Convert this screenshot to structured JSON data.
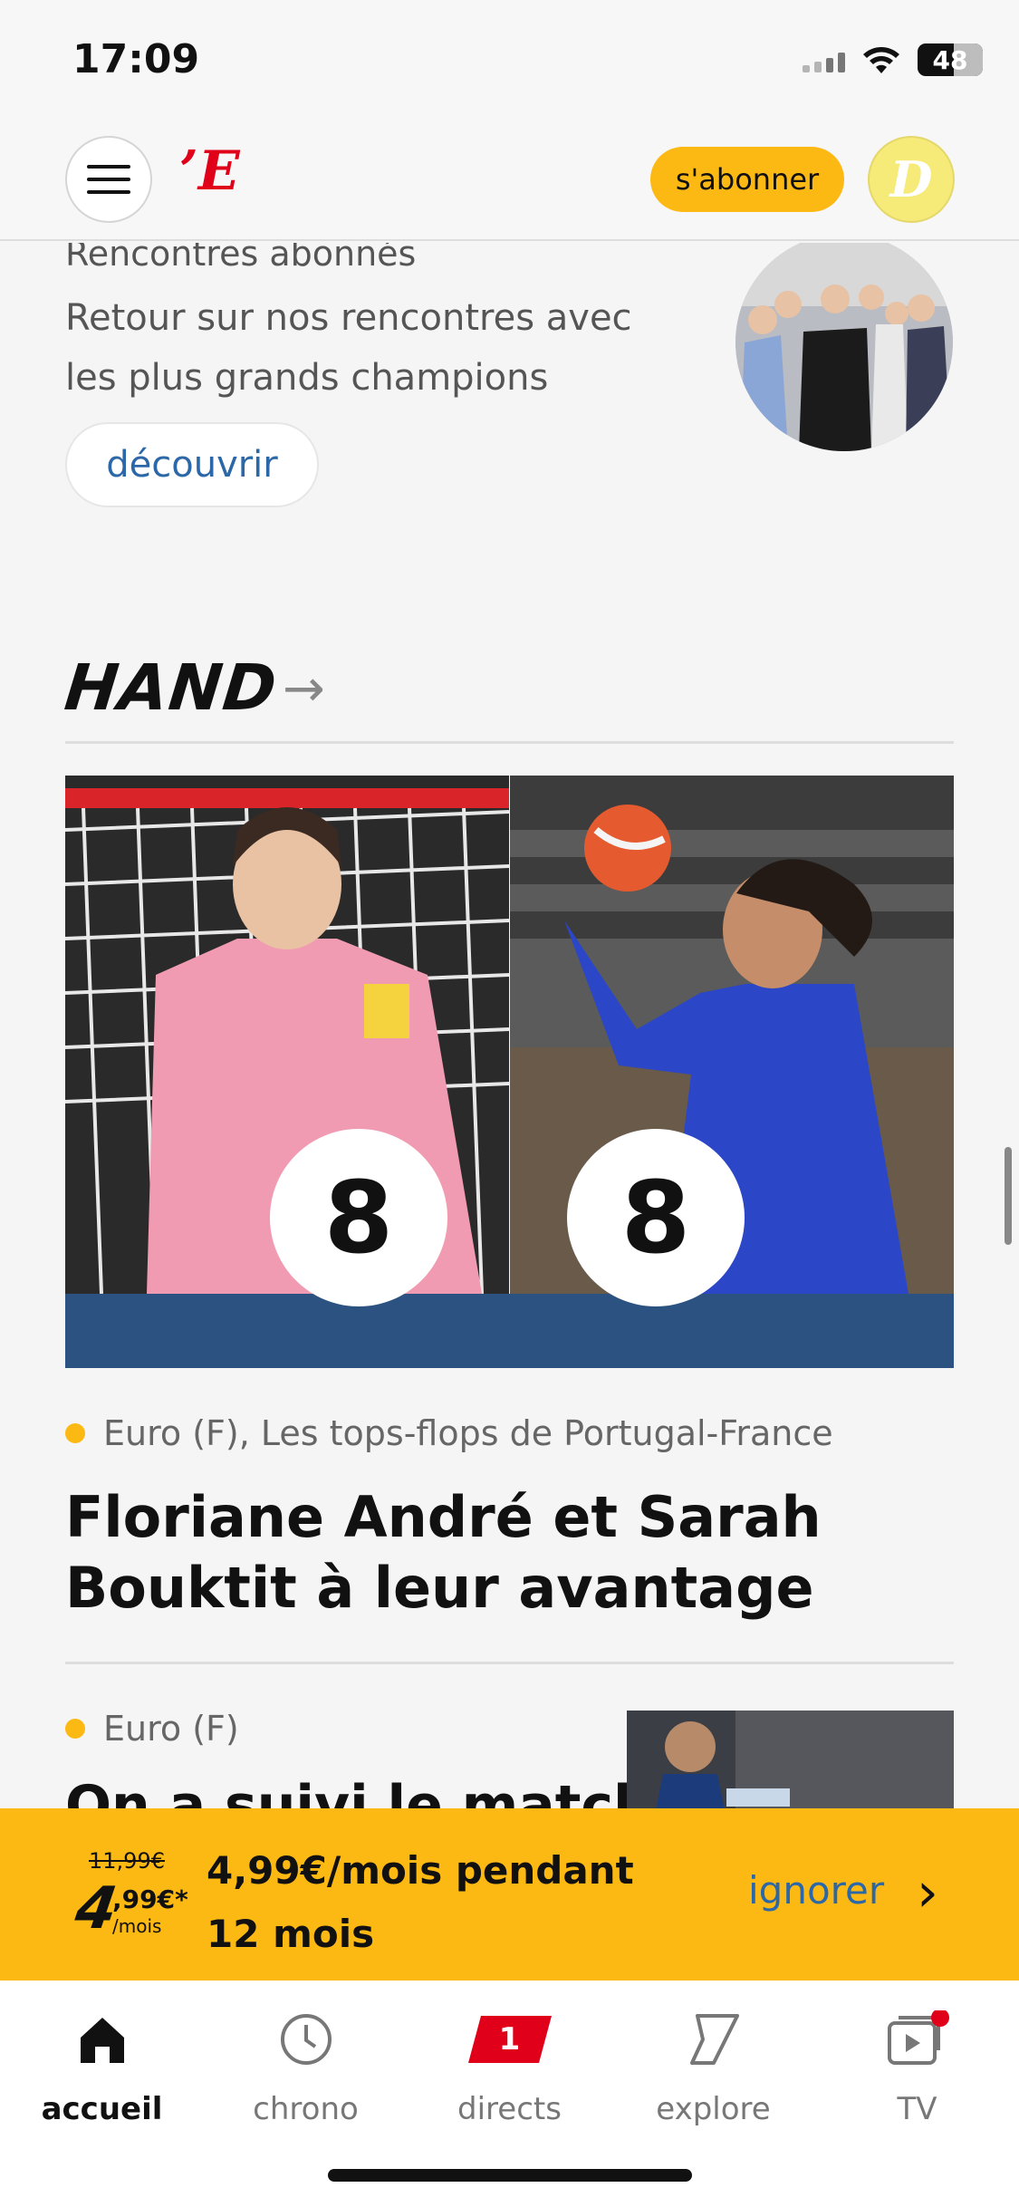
{
  "status_bar": {
    "time": "17:09",
    "battery": "48"
  },
  "header": {
    "logo": "’E",
    "subscribe_label": "s'abonner",
    "avatar_initial": "D"
  },
  "promo": {
    "kicker": "Rencontres abonnés",
    "description": "Retour sur nos rencontres avec les plus grands champions",
    "cta_label": "découvrir"
  },
  "section": {
    "title": "HAND",
    "arrow": "→"
  },
  "article_main": {
    "rating_left": "8",
    "rating_right": "8",
    "kicker": "Euro (F), Les tops-flops de Portugal-France",
    "headline": "Floriane André et Sarah Bouktit à leur avantage"
  },
  "article_second": {
    "kicker": "Euro (F)",
    "headline": "On a suivi le match des"
  },
  "offer": {
    "old_price": "11,99€",
    "price": "4",
    "price_cents": ",99€*",
    "per": "/mois",
    "text": "4,99€/mois pendant 12 mois",
    "ignore_label": "ignorer",
    "chevron": "›"
  },
  "tab_bar": {
    "tabs": [
      {
        "label": "accueil"
      },
      {
        "label": "chrono"
      },
      {
        "label": "directs",
        "badge": "1"
      },
      {
        "label": "explore"
      },
      {
        "label": "TV"
      }
    ]
  },
  "colors": {
    "accent_yellow": "#fdb913",
    "brand_red": "#e1001a",
    "link_blue": "#2c68a8",
    "band_blue": "#2c5282"
  }
}
